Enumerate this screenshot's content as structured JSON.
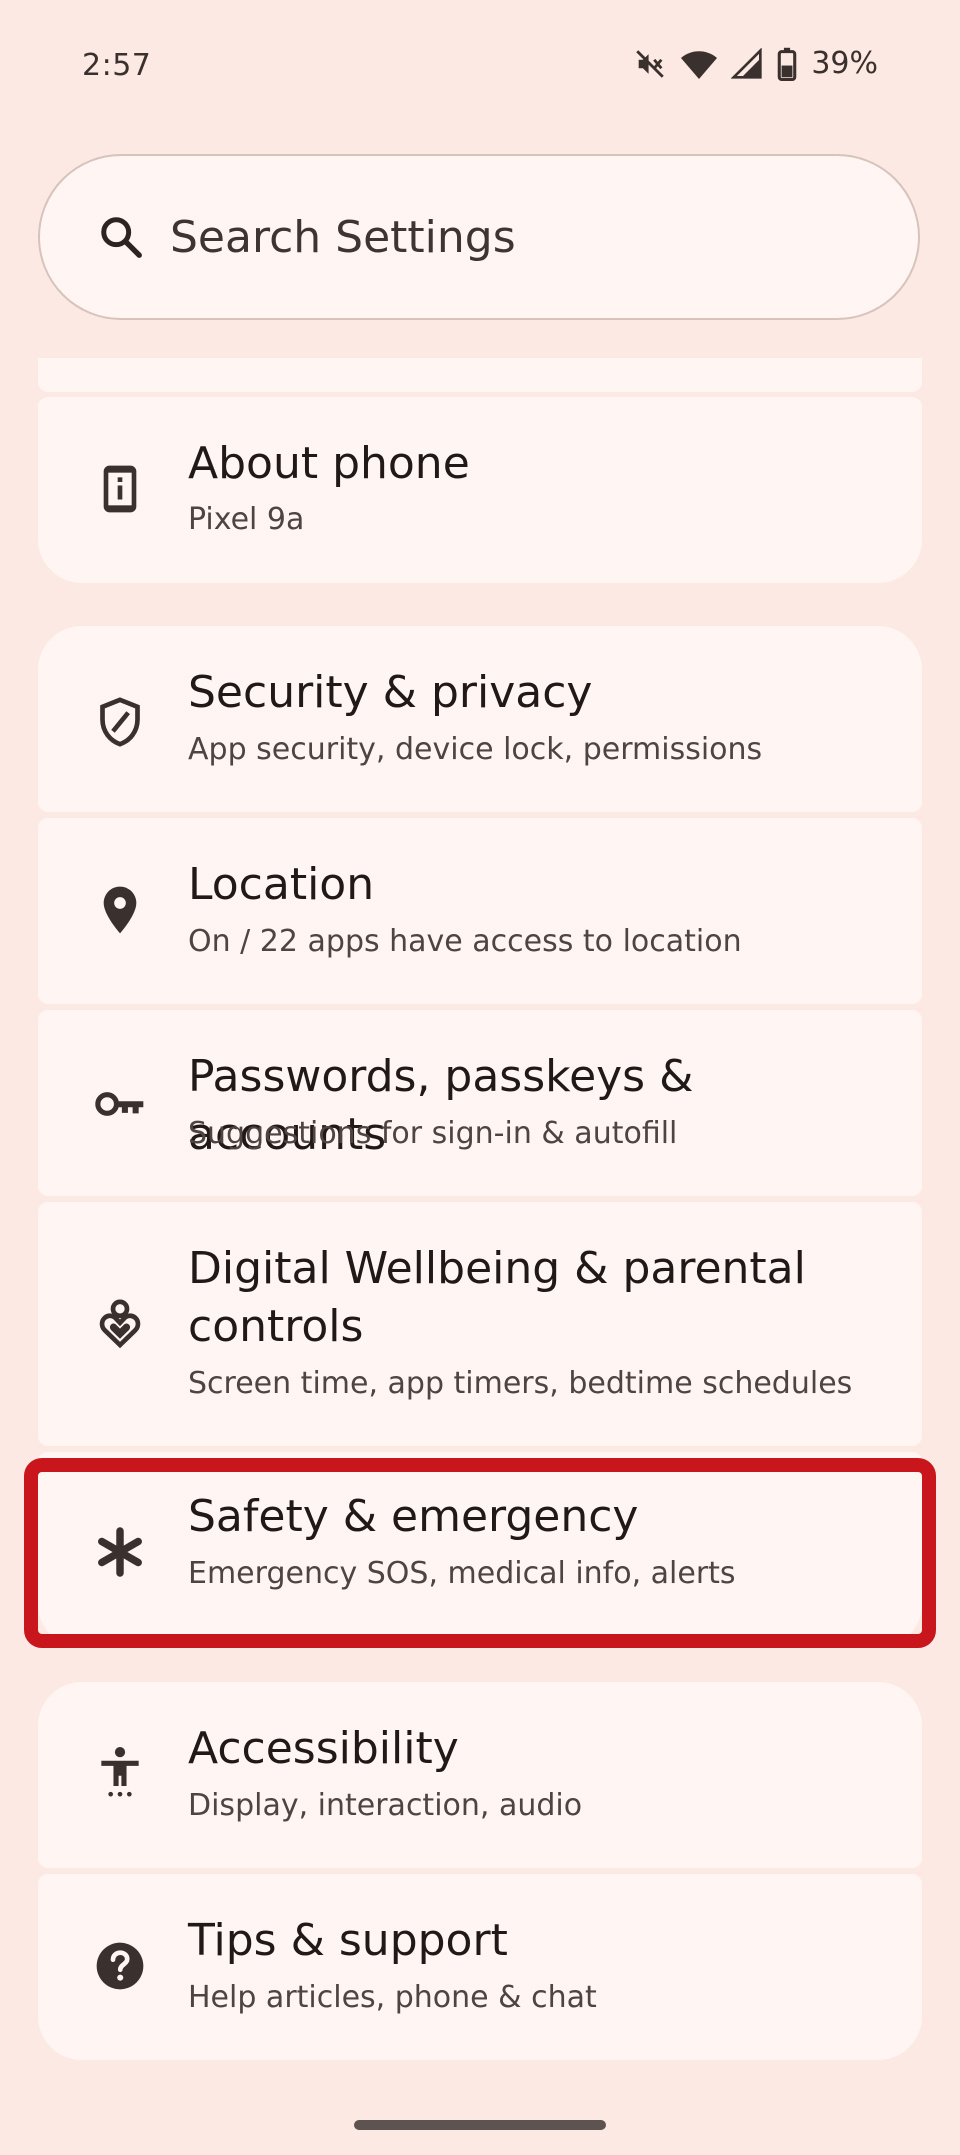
{
  "status_bar": {
    "time": "2:57",
    "battery_percent": "39%",
    "icons": [
      "mute-icon",
      "wifi-icon",
      "signal-icon",
      "battery-icon"
    ]
  },
  "search": {
    "placeholder": "Search Settings"
  },
  "settings": {
    "about_phone": {
      "title": "About phone",
      "subtitle": "Pixel 9a",
      "icon": "phone-info-icon"
    },
    "security": {
      "title": "Security & privacy",
      "subtitle": "App security, device lock, permissions",
      "icon": "shield-icon"
    },
    "location": {
      "title": "Location",
      "subtitle": "On / 22 apps have access to location",
      "icon": "location-pin-icon"
    },
    "passwords": {
      "title": "Passwords, passkeys & accounts",
      "subtitle": "Suggestions for sign-in & autofill",
      "icon": "key-icon"
    },
    "wellbeing": {
      "title": "Digital Wellbeing & parental controls",
      "subtitle": "Screen time, app timers, bedtime schedules",
      "icon": "wellbeing-heart-icon"
    },
    "safety": {
      "title": "Safety & emergency",
      "subtitle": "Emergency SOS, medical info, alerts",
      "icon": "asterisk-icon"
    },
    "accessibility": {
      "title": "Accessibility",
      "subtitle": "Display, interaction, audio",
      "icon": "accessibility-icon"
    },
    "tips": {
      "title": "Tips & support",
      "subtitle": "Help articles, phone & chat",
      "icon": "help-icon"
    }
  },
  "colors": {
    "background": "#fde9e3",
    "card": "#fff6f3",
    "highlight": "#c8161c",
    "text": "#211917"
  }
}
